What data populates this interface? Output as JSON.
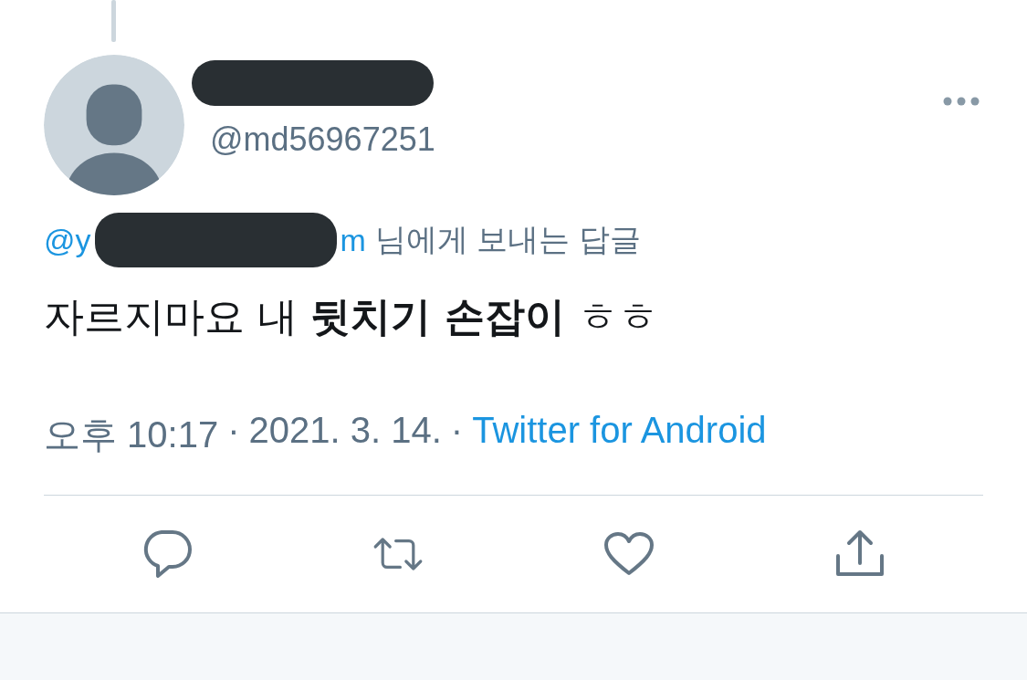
{
  "author": {
    "handle": "@md56967251",
    "name_redacted": true
  },
  "reply_to": {
    "prefix": "@y",
    "redacted": true,
    "suffix": "m",
    "label": "님에게 보내는 답글"
  },
  "text": "자르지마요 내 **뒷치기 손잡이** ㅎㅎ",
  "meta": {
    "time": "오후 10:17",
    "date": "2021. 3. 14.",
    "source": "Twitter for Android",
    "separator": "·"
  },
  "actions": [
    {
      "kind": "reply"
    },
    {
      "kind": "retweet"
    },
    {
      "kind": "like"
    },
    {
      "kind": "share"
    }
  ]
}
